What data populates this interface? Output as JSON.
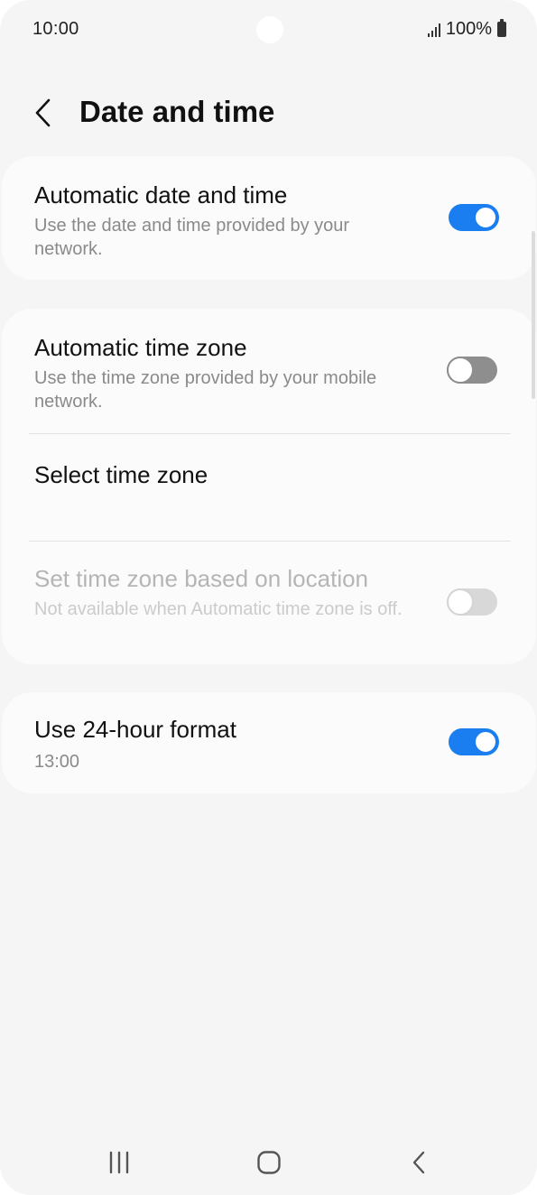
{
  "status_bar": {
    "time": "10:00",
    "battery_text": "100%",
    "icons": [
      "signal-icon",
      "battery-icon"
    ]
  },
  "header": {
    "back_icon": "chevron-left-icon",
    "title": "Date and time"
  },
  "settings": {
    "auto_date_time": {
      "title": "Automatic date and time",
      "subtitle": "Use the date and time provided by your network.",
      "enabled": true
    },
    "auto_time_zone": {
      "title": "Automatic time zone",
      "subtitle": "Use the time zone provided by your mobile network.",
      "enabled": false
    },
    "select_time_zone": {
      "title": "Select time zone"
    },
    "location_time_zone": {
      "title": "Set time zone based on location",
      "subtitle": "Not available when Automatic time zone is off.",
      "enabled": false,
      "disabled": true
    },
    "hour_format_24": {
      "title": "Use 24-hour format",
      "subtitle": "13:00",
      "enabled": true
    }
  },
  "nav_bar": {
    "icons": [
      "recents-icon",
      "home-icon",
      "back-icon"
    ]
  },
  "colors": {
    "accent": "#1a7ef0",
    "background": "#f5f5f5",
    "card": "#fbfbfb"
  }
}
